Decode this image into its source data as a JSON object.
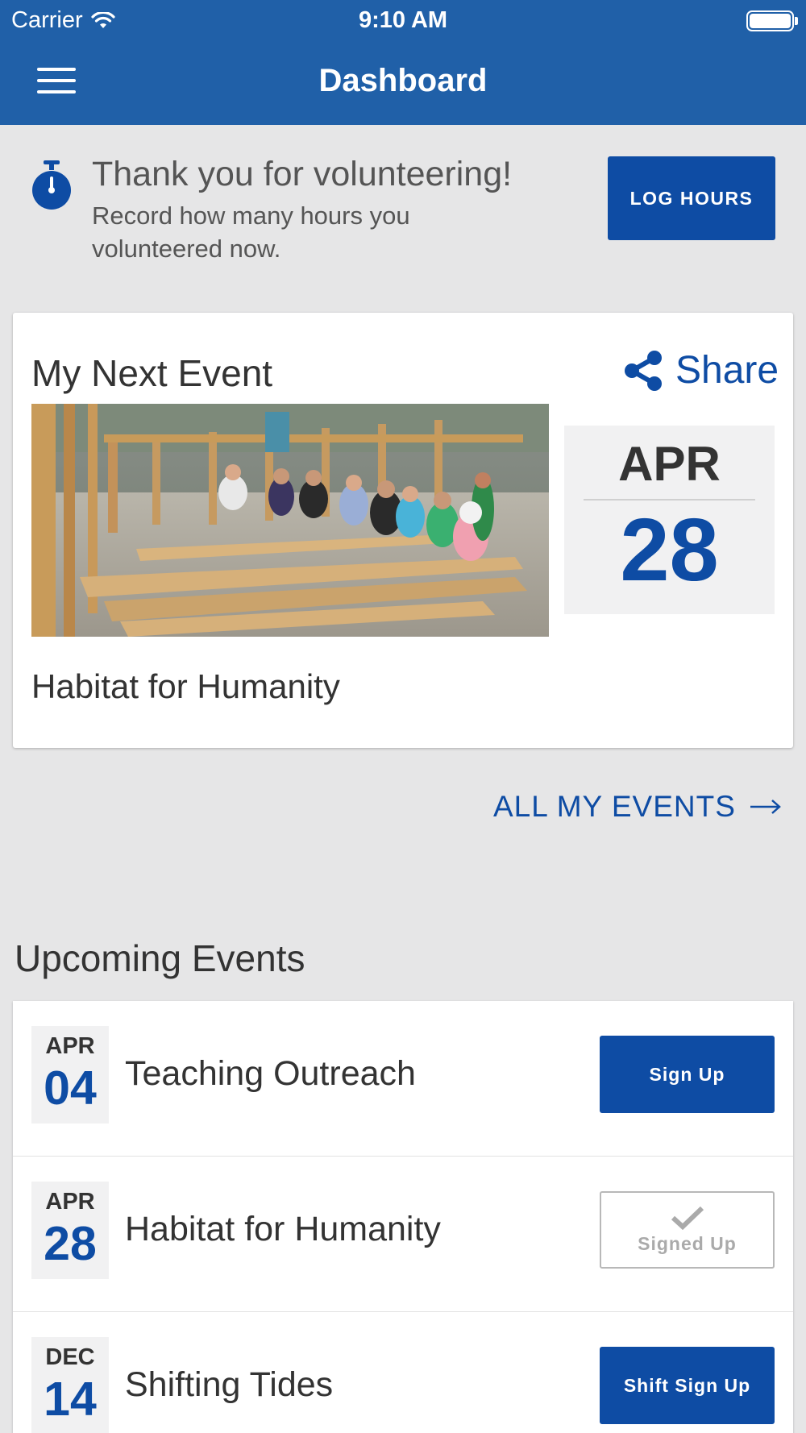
{
  "status_bar": {
    "carrier": "Carrier",
    "time": "9:10 AM"
  },
  "header": {
    "title": "Dashboard",
    "menu_icon": "hamburger-menu-icon"
  },
  "banner": {
    "icon": "stopwatch-icon",
    "title": "Thank you for volunteering!",
    "subtitle": "Record how many hours you volunteered now.",
    "button_label": "LOG HOURS"
  },
  "next_event": {
    "heading": "My Next Event",
    "share_label": "Share",
    "share_icon": "share-icon",
    "month": "APR",
    "day": "28",
    "name": "Habitat for Humanity"
  },
  "all_events_link": "ALL MY EVENTS",
  "upcoming": {
    "heading": "Upcoming Events",
    "items": [
      {
        "month": "APR",
        "day": "04",
        "name": "Teaching Outreach",
        "action": "Sign Up",
        "state": "available"
      },
      {
        "month": "APR",
        "day": "28",
        "name": "Habitat for Humanity",
        "action": "Signed Up",
        "state": "signed"
      },
      {
        "month": "DEC",
        "day": "14",
        "name": "Shifting Tides",
        "action": "Shift Sign Up",
        "state": "available"
      }
    ]
  },
  "colors": {
    "header": "#2060a8",
    "accent": "#0e4ca4",
    "background": "#e6e6e7"
  }
}
